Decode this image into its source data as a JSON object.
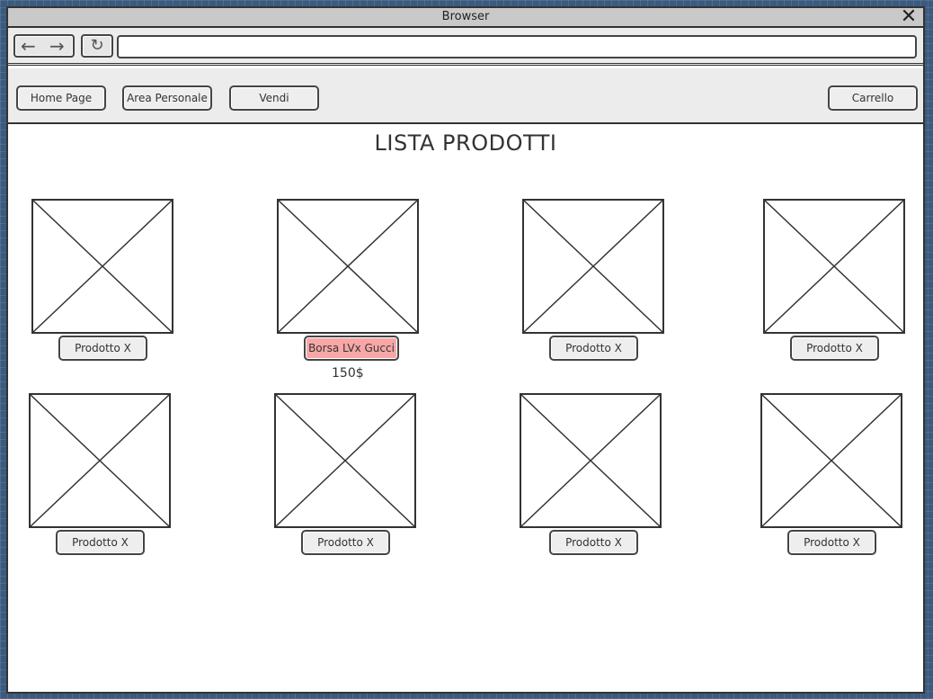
{
  "window": {
    "title": "Browser"
  },
  "address_bar": {
    "value": ""
  },
  "menu": {
    "home_label": "Home Page",
    "area_label": "Area Personale",
    "vendi_label": "Vendi",
    "carrello_label": "Carrello"
  },
  "page_title": "LISTA PRODOTTI",
  "products": [
    {
      "label": "Prodotto X"
    },
    {
      "label": "Borsa LVx Gucci",
      "price": "150$",
      "highlighted": true
    },
    {
      "label": "Prodotto X"
    },
    {
      "label": "Prodotto X"
    },
    {
      "label": "Prodotto X"
    },
    {
      "label": "Prodotto X"
    },
    {
      "label": "Prodotto X"
    },
    {
      "label": "Prodotto X"
    }
  ],
  "colors": {
    "highlight": "#f7a7a7",
    "background": "#3a5a7e"
  }
}
